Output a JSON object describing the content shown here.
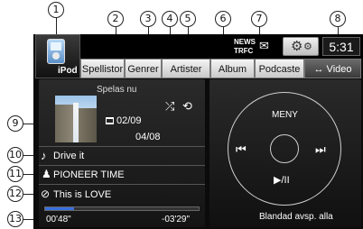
{
  "callouts": [
    "1",
    "2",
    "3",
    "4",
    "5",
    "6",
    "7",
    "8",
    "9",
    "10",
    "11",
    "12",
    "13"
  ],
  "header": {
    "source_label": "iPod",
    "news_label": "NEWS",
    "trfc_label": "TRFC",
    "clock": "5:31"
  },
  "tabs": [
    {
      "label": "Spellistor",
      "active": false
    },
    {
      "label": "Genrer",
      "active": false
    },
    {
      "label": "Artister",
      "active": false
    },
    {
      "label": "Album",
      "active": false
    },
    {
      "label": "Podcaste",
      "active": false
    },
    {
      "label": "↔ Video",
      "active": true
    }
  ],
  "now_playing": {
    "title": "Spelas nu",
    "track_index": "02/09",
    "album_index": "04/08",
    "song": "Drive it",
    "artist": "PIONEER TIME",
    "album": "This is LOVE",
    "elapsed": "00'48\"",
    "remaining": "-03'29\"",
    "progress_fraction": 0.19
  },
  "controls": {
    "menu_label": "MENY",
    "prev_icon": "prev-track-icon",
    "next_icon": "next-track-icon",
    "play_pause_label": "▶/II",
    "shuffle_all_label": "Blandad avsp. alla"
  },
  "colors": {
    "screen_bg": "#0b0b0b",
    "tab_active": "#4a4a4a",
    "progress": "#3a6fe0"
  }
}
